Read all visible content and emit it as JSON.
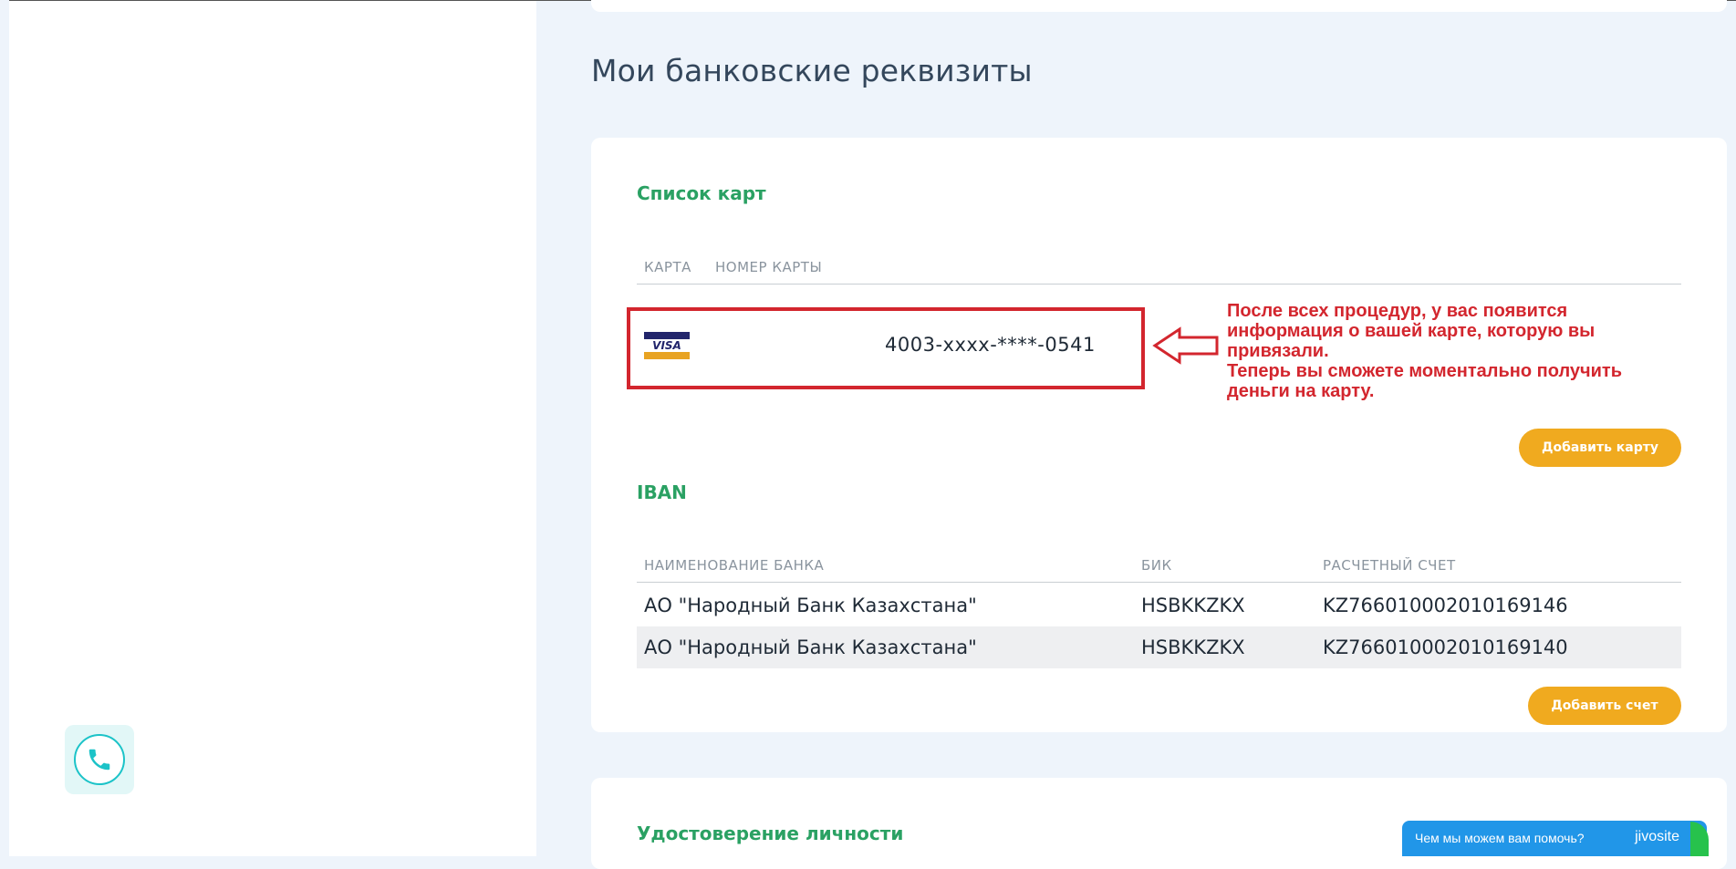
{
  "page": {
    "title": "Мои банковские реквизиты"
  },
  "cards_section": {
    "title": "Список карт",
    "columns": [
      "КАРТА",
      "НОМЕР КАРТЫ"
    ],
    "rows": [
      {
        "brand": "VISA",
        "number": "4003-xxxx-****-0541"
      }
    ],
    "add_button": "Добавить карту"
  },
  "annotation": {
    "lines": [
      "После всех процедур, у вас появится",
      "информация о вашей карте, которую вы",
      "привязали.",
      "Теперь вы сможете моментально получить",
      "деньги на карту."
    ],
    "color": "#d3262e"
  },
  "iban_section": {
    "title": "IBAN",
    "columns": [
      "НАИМЕНОВАНИЕ БАНКА",
      "БИК",
      "РАСЧЕТНЫЙ СЧЕТ"
    ],
    "rows": [
      {
        "bank": "АО \"Народный Банк Казахстана\"",
        "bic": "HSBKKZKX",
        "account": "KZ766010002010169146"
      },
      {
        "bank": "АО \"Народный Банк Казахстана\"",
        "bic": "HSBKKZKX",
        "account": "KZ766010002010169140"
      }
    ],
    "add_button": "Добавить счет"
  },
  "identity_section": {
    "title": "Удостоверение личности"
  },
  "chat_widget": {
    "prompt": "Чем мы можем вам помочь?",
    "brand": "jivosite"
  },
  "colors": {
    "accent_green": "#2aa163",
    "button_orange": "#f0aa1f",
    "chat_blue": "#2196e8",
    "phone_teal": "#1cc3c8"
  },
  "icons": {
    "phone": "phone-icon",
    "card_brand": "visa-logo-icon",
    "arrow": "left-arrow-icon"
  }
}
